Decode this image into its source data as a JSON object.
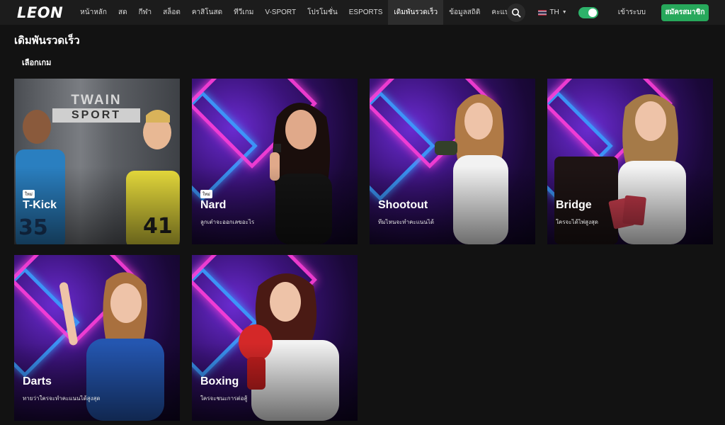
{
  "header": {
    "logo": "LEON",
    "nav": [
      "หน้าหลัก",
      "สด",
      "กีฬา",
      "สล็อต",
      "คาสิโนสด",
      "ทีวีเกม",
      "V-SPORT",
      "โปรโมชั่น",
      "ESPORTS",
      "เดิมพันรวดเร็ว",
      "ข้อมูลสถิติ",
      "คะแนนสด"
    ],
    "active_index": 9,
    "language": "TH",
    "login_label": "เข้าระบบ",
    "register_label": "สมัครสมาชิก"
  },
  "page": {
    "title": "เดิมพันรวดเร็ว",
    "section_title": "เลือกเกม"
  },
  "games": [
    {
      "name": "T-Kick",
      "badge": "ใหม่",
      "desc": "",
      "sign_top": "TWAIN",
      "sign_bottom": "SPORT"
    },
    {
      "name": "Nard",
      "badge": "ใหม่",
      "desc": "ลูกเต๋าจะออกเลขอะไร"
    },
    {
      "name": "Shootout",
      "badge": "",
      "desc": "ทีมไหนจะทำคะแนนได้"
    },
    {
      "name": "Bridge",
      "badge": "",
      "desc": "ใครจะได้ไพ่สูงสุด"
    },
    {
      "name": "Darts",
      "badge": "",
      "desc": "ทายว่าใครจะทำคะแนนได้สูงสุด"
    },
    {
      "name": "Boxing",
      "badge": "",
      "desc": "ใครจะชนะการต่อสู้"
    }
  ],
  "colors": {
    "background": "#121212",
    "header": "#1c1c1c",
    "register_button": "#27a85b",
    "toggle": "#2db36a"
  }
}
